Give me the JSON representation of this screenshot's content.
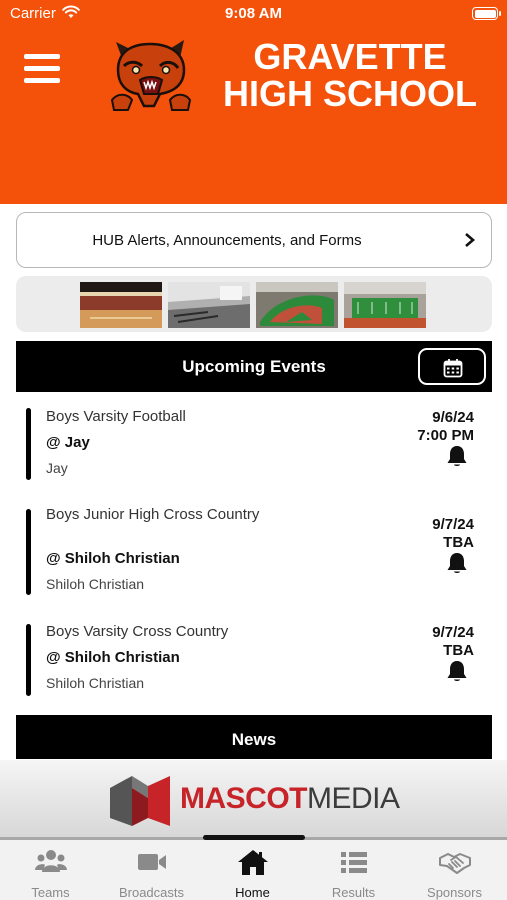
{
  "status_bar": {
    "carrier": "Carrier",
    "time": "9:08 AM"
  },
  "header": {
    "title_line1": "GRAVETTE",
    "title_line2": "HIGH SCHOOL",
    "background_color": "#f4510a"
  },
  "alerts": {
    "label": "HUB Alerts, Announcements, and Forms"
  },
  "gallery": {
    "photos": [
      "gym-interior-photo",
      "classroom-photo",
      "baseball-field-photo",
      "football-stadium-photo"
    ]
  },
  "upcoming": {
    "title": "Upcoming Events",
    "events": [
      {
        "sport": "Boys Varsity Football",
        "opponent": "@ Jay",
        "location": "Jay",
        "date": "9/6/24",
        "time": "7:00 PM"
      },
      {
        "sport": "Boys Junior High Cross Country",
        "opponent": "@ Shiloh Christian",
        "location": "Shiloh Christian",
        "date": "9/7/24",
        "time": "TBA"
      },
      {
        "sport": "Boys Varsity Cross Country",
        "opponent": "@ Shiloh Christian",
        "location": "Shiloh Christian",
        "date": "9/7/24",
        "time": "TBA"
      }
    ]
  },
  "news": {
    "title": "News"
  },
  "sponsor": {
    "word1": "MASCOT",
    "word2": "MEDIA"
  },
  "tabs": [
    {
      "label": "Teams",
      "icon": "people-icon"
    },
    {
      "label": "Broadcasts",
      "icon": "video-camera-icon"
    },
    {
      "label": "Home",
      "icon": "house-icon"
    },
    {
      "label": "Results",
      "icon": "list-icon"
    },
    {
      "label": "Sponsors",
      "icon": "handshake-icon"
    }
  ],
  "colors": {
    "brand_orange": "#f4510a",
    "sponsor_red": "#c7242a",
    "active_tab": "#111111",
    "inactive_tab": "#8a8a8a"
  }
}
